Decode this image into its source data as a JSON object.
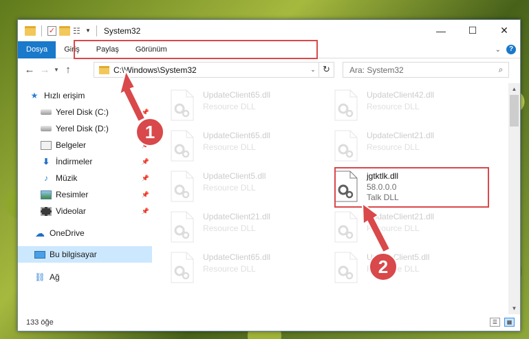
{
  "window": {
    "title": "System32",
    "controls": {
      "minimize": "—",
      "maximize": "☐",
      "close": "✕"
    }
  },
  "ribbon": {
    "tabs": [
      {
        "label": "Dosya",
        "active": true
      },
      {
        "label": "Giriş",
        "active": false
      },
      {
        "label": "Paylaş",
        "active": false
      },
      {
        "label": "Görünüm",
        "active": false
      }
    ],
    "help_icon": "question-icon",
    "expand_icon": "chevron-down-icon"
  },
  "navbar": {
    "address": "C:\\Windows\\System32",
    "search_placeholder": "Ara: System32"
  },
  "sidebar": {
    "items": [
      {
        "label": "Hızlı erişim",
        "icon": "star-icon",
        "pinned": false
      },
      {
        "label": "Yerel Disk (C:)",
        "icon": "disk-icon",
        "pinned": true
      },
      {
        "label": "Yerel Disk (D:)",
        "icon": "disk-icon",
        "pinned": true
      },
      {
        "label": "Belgeler",
        "icon": "documents-icon",
        "pinned": true
      },
      {
        "label": "İndirmeler",
        "icon": "download-icon",
        "pinned": true
      },
      {
        "label": "Müzik",
        "icon": "music-icon",
        "pinned": true
      },
      {
        "label": "Resimler",
        "icon": "pictures-icon",
        "pinned": true
      },
      {
        "label": "Videolar",
        "icon": "videos-icon",
        "pinned": true
      },
      {
        "label": "OneDrive",
        "icon": "cloud-icon",
        "pinned": false
      },
      {
        "label": "Bu bilgisayar",
        "icon": "computer-icon",
        "pinned": false,
        "selected": true
      },
      {
        "label": "Ağ",
        "icon": "network-icon",
        "pinned": false
      }
    ]
  },
  "files": [
    {
      "name": "UpdateClient65.dll",
      "desc": "Resource DLL",
      "faded": true
    },
    {
      "name": "UpdateClient42.dll",
      "desc": "Resource DLL",
      "faded": true
    },
    {
      "name": "UpdateClient65.dll",
      "desc": "Resource DLL",
      "faded": true
    },
    {
      "name": "UpdateClient21.dll",
      "desc": "Resource DLL",
      "faded": true
    },
    {
      "name": "UpdateClient5.dll",
      "desc": "Resource DLL",
      "faded": true
    },
    {
      "name": "jgtktlk.dll",
      "version": "58.0.0.0",
      "desc": "Talk DLL",
      "faded": false
    },
    {
      "name": "UpdateClient21.dll",
      "desc": "Resource DLL",
      "faded": true
    },
    {
      "name": "UpdateClient21.dll",
      "desc": "Resource DLL",
      "faded": true
    },
    {
      "name": "UpdateClient65.dll",
      "desc": "Resource DLL",
      "faded": true
    },
    {
      "name": "UpdateClient5.dll",
      "desc": "Resource DLL",
      "faded": true
    }
  ],
  "statusbar": {
    "count": "133 öğe"
  },
  "annotations": {
    "callout_1": "1",
    "callout_2": "2",
    "color": "#d9484a"
  }
}
